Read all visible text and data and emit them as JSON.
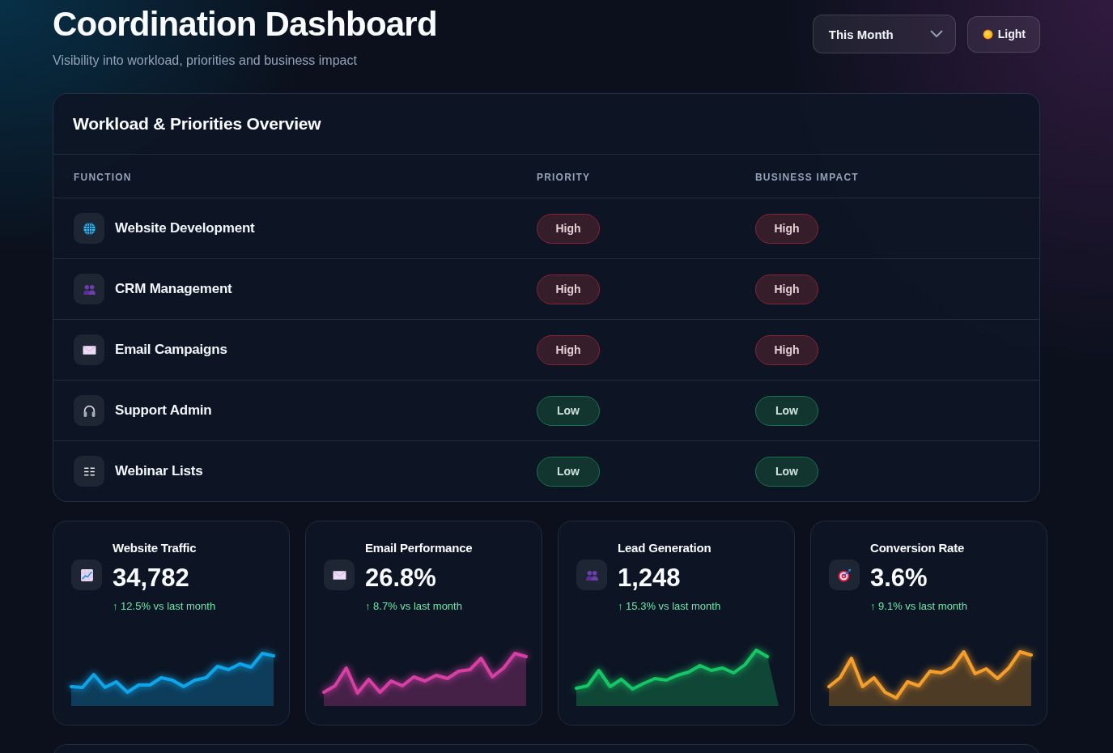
{
  "header": {
    "title": "Coordination Dashboard",
    "subtitle": "Visibility into workload, priorities and business impact"
  },
  "period_select": {
    "value": "This Month"
  },
  "theme_toggle": {
    "label": "Light"
  },
  "workload_table": {
    "title": "Workload & Priorities Overview",
    "columns": [
      "FUNCTION",
      "PRIORITY",
      "BUSINESS IMPACT"
    ],
    "rows": [
      {
        "function": "Website Development",
        "priority": {
          "label": "High",
          "color": "#8a2338"
        },
        "business_impact": {
          "label": "High",
          "color": "#8a2338"
        }
      },
      {
        "function": "CRM Management",
        "priority": {
          "label": "High",
          "color": "#8a2338"
        },
        "business_impact": {
          "label": "High",
          "color": "#8a2338"
        }
      },
      {
        "function": "Email Campaigns",
        "priority": {
          "label": "High",
          "color": "#8a2338"
        },
        "business_impact": {
          "label": "High",
          "color": "#8a2338"
        }
      },
      {
        "function": "Support Admin",
        "priority": {
          "label": "Low",
          "color": "#17734f"
        },
        "business_impact": {
          "label": "Low",
          "color": "#17734f"
        }
      },
      {
        "function": "Webinar Lists",
        "priority": {
          "label": "Low",
          "color": "#17734f"
        },
        "business_impact": {
          "label": "Low",
          "color": "#17734f"
        }
      }
    ]
  },
  "kpis": [
    {
      "title": "Website Traffic",
      "value": "34,782",
      "change": "↑ 12.5% vs last month",
      "color": "#0ea5e9"
    },
    {
      "title": "Email Performance",
      "value": "26.8%",
      "change": "↑ 8.7% vs last month",
      "color": "#d63fa4"
    },
    {
      "title": "Lead Generation",
      "value": "1,248",
      "change": "↑ 15.3% vs last month",
      "color": "#16c565"
    },
    {
      "title": "Conversion Rate",
      "value": "3.6%",
      "change": "↑ 9.1% vs last month",
      "color": "#f59e2b"
    }
  ]
}
